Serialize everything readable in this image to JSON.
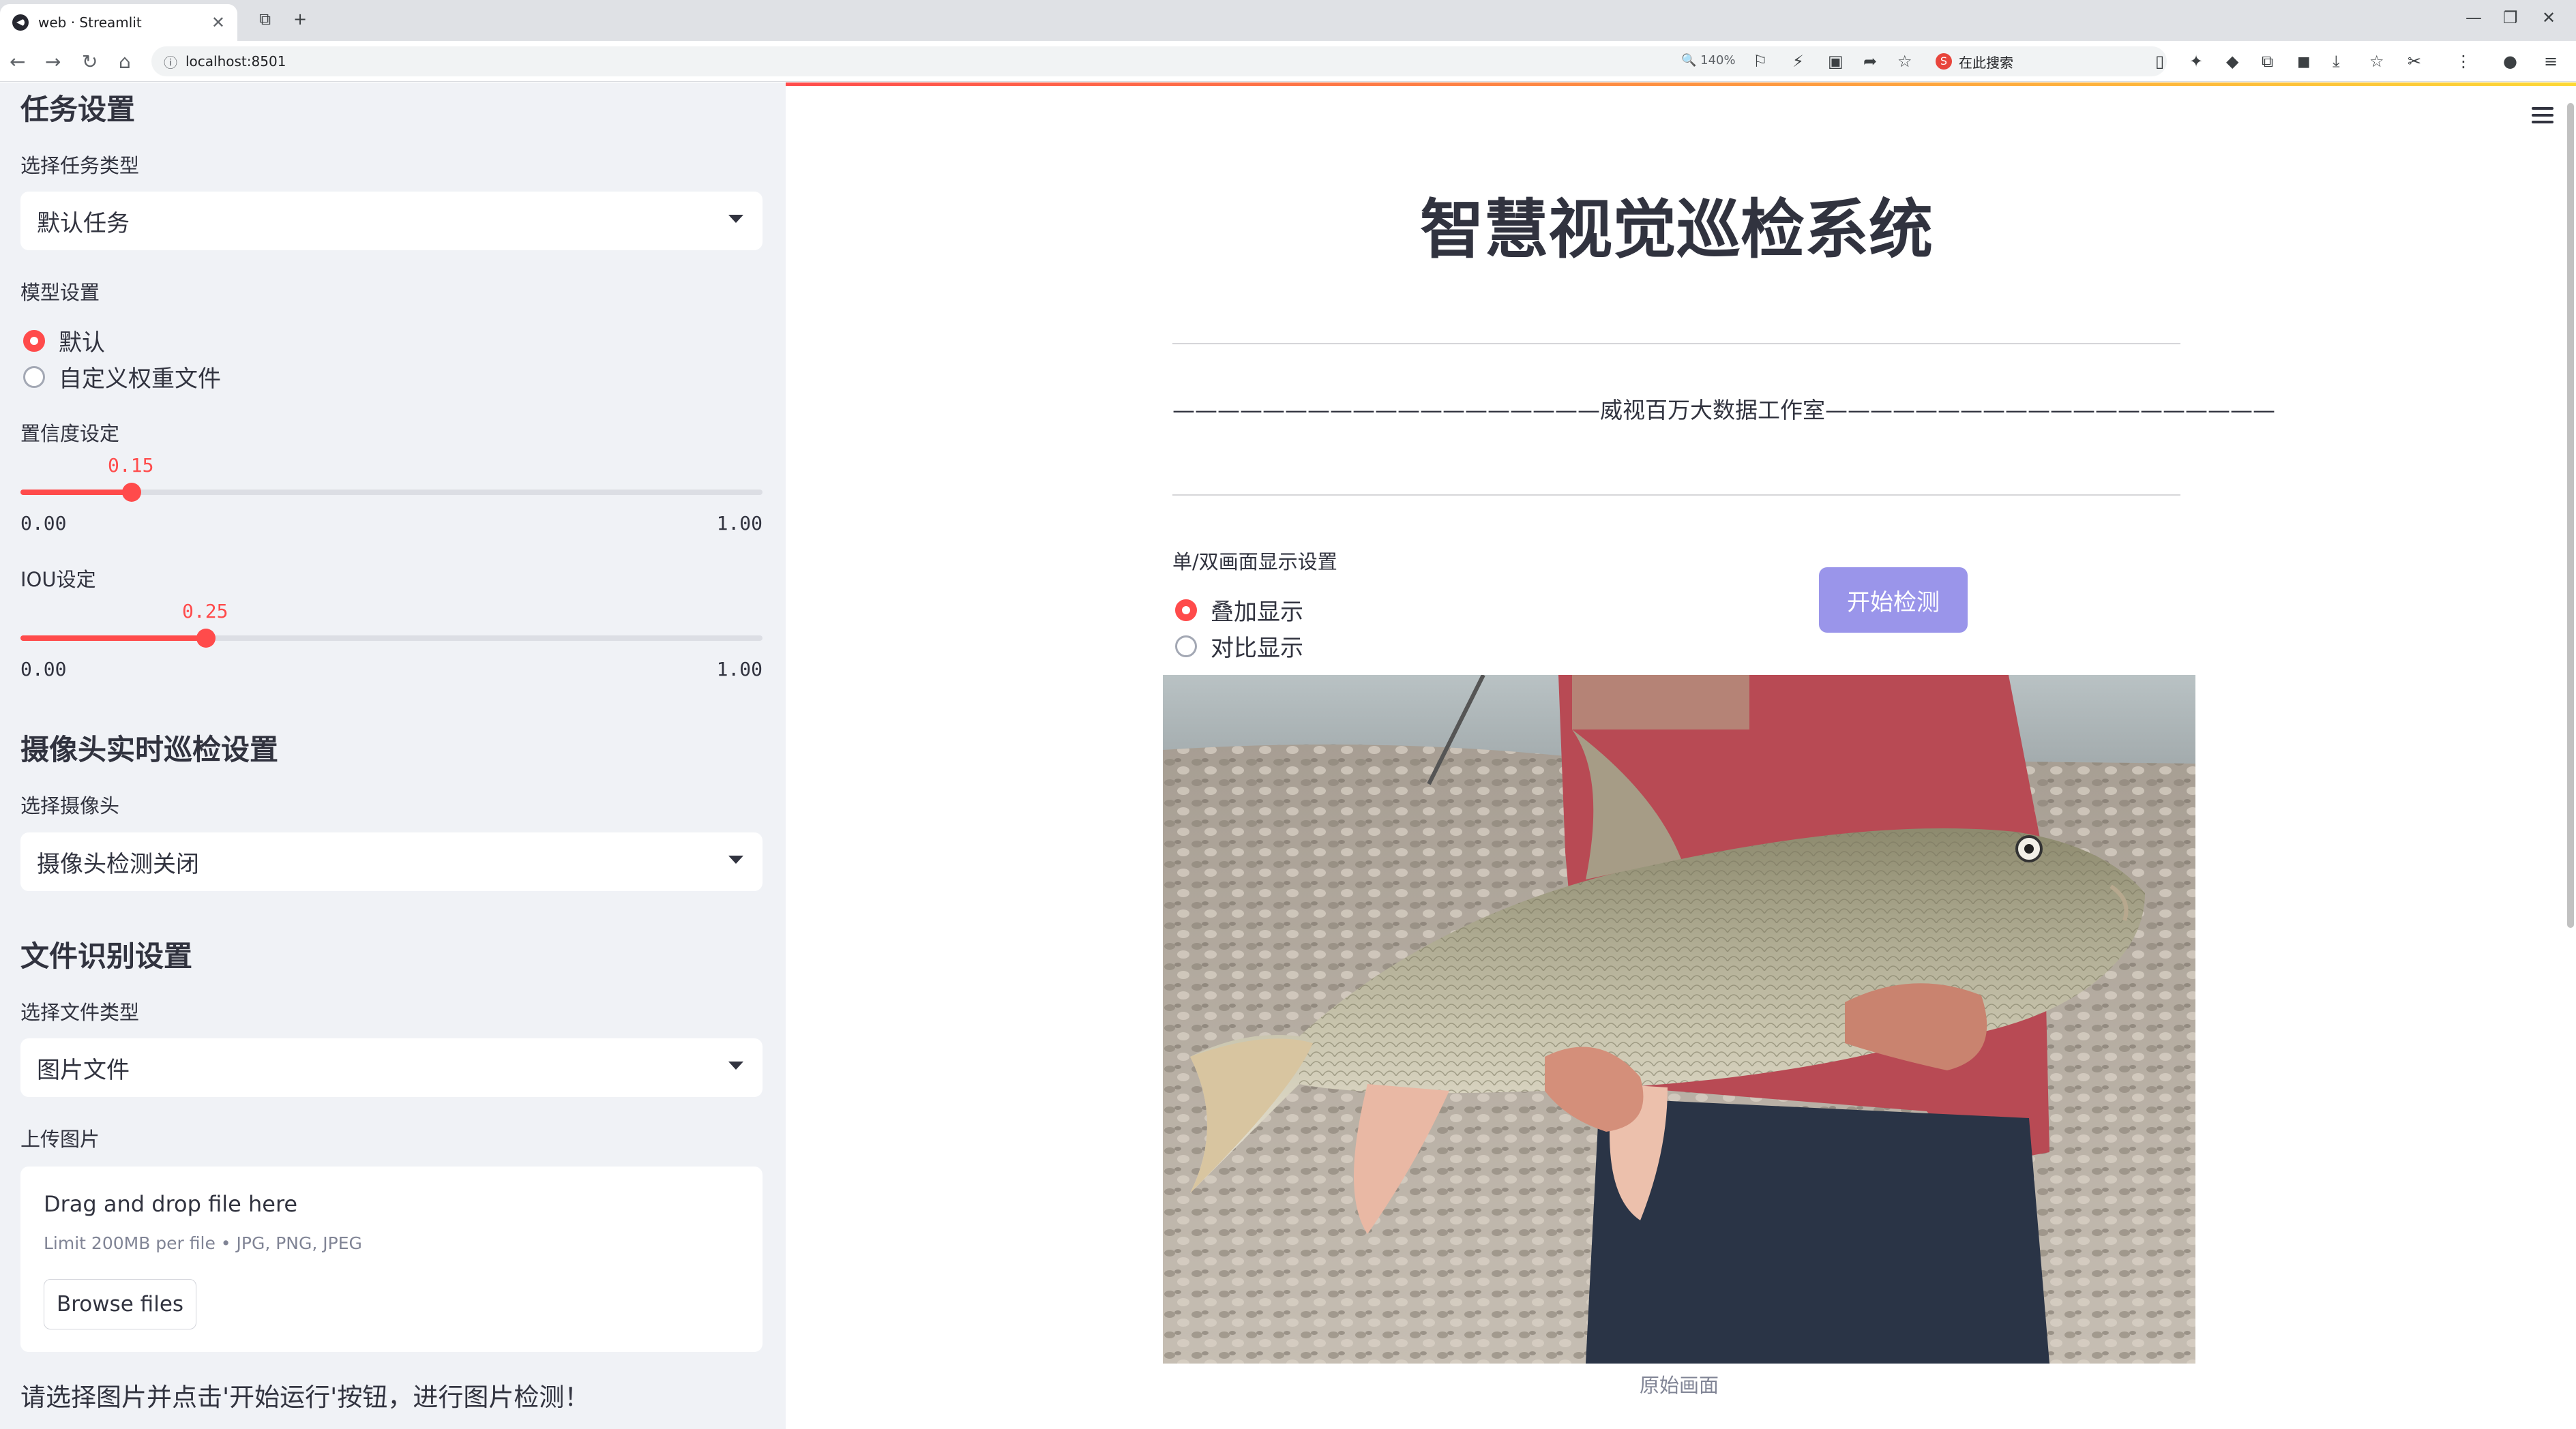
{
  "browser": {
    "tab_title": "web · Streamlit",
    "url": "localhost:8501",
    "zoom": "140%",
    "search_placeholder": "在此搜索"
  },
  "sidebar": {
    "task_heading": "任务设置",
    "task_type_label": "选择任务类型",
    "task_type_value": "默认任务",
    "model_label": "模型设置",
    "model_options": [
      "默认",
      "自定义权重文件"
    ],
    "model_selected": "默认",
    "conf_label": "置信度设定",
    "conf_value": "0.15",
    "conf_min": "0.00",
    "conf_max": "1.00",
    "conf_fraction": 0.15,
    "iou_label": "IOU设定",
    "iou_value": "0.25",
    "iou_min": "0.00",
    "iou_max": "1.00",
    "iou_fraction": 0.25,
    "camera_heading": "摄像头实时巡检设置",
    "camera_label": "选择摄像头",
    "camera_value": "摄像头检测关闭",
    "file_heading": "文件识别设置",
    "file_type_label": "选择文件类型",
    "file_type_value": "图片文件",
    "upload_label": "上传图片",
    "upload_title": "Drag and drop file here",
    "upload_limit": "Limit 200MB per file • JPG, PNG, JPEG",
    "browse_label": "Browse files",
    "note": "请选择图片并点击'开始运行'按钮，进行图片检测！"
  },
  "main": {
    "title": "智慧视觉巡检系统",
    "studio": "———————————————————威视百万大数据工作室————————————————————",
    "display_label": "单/双画面显示设置",
    "display_options": [
      "叠加显示",
      "对比显示"
    ],
    "display_selected": "叠加显示",
    "start_button": "开始检测",
    "image_caption": "原始画面"
  },
  "colors": {
    "accent": "#ff4b4b",
    "button": "#9a95ea",
    "sidebar_bg": "#f0f2f6"
  }
}
